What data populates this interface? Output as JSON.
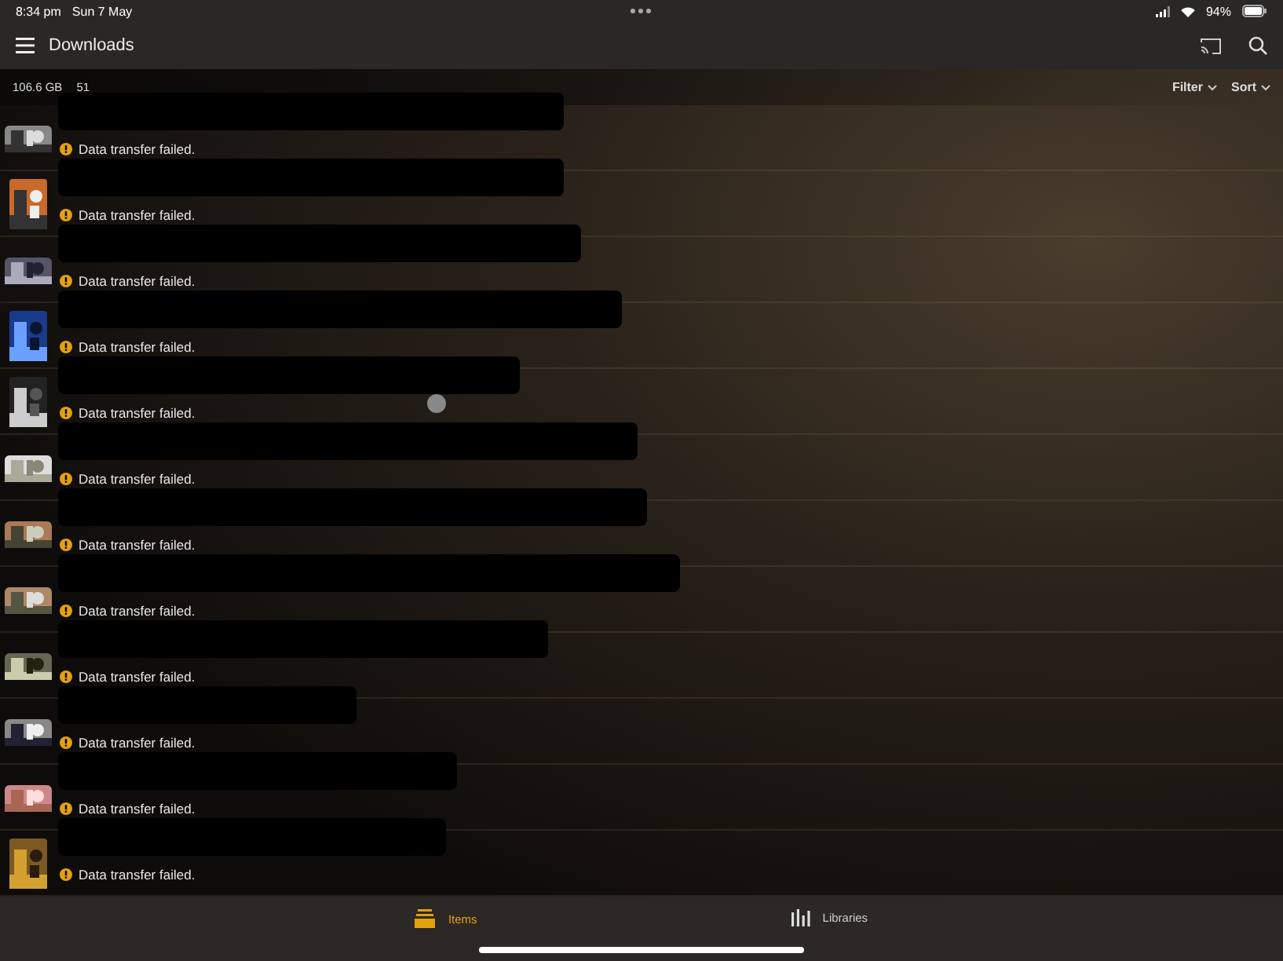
{
  "status_bar": {
    "time": "8:34 pm",
    "date": "Sun 7 May",
    "battery": "94%"
  },
  "nav": {
    "title": "Downloads"
  },
  "summary": {
    "size": "106.6 GB",
    "count": "51",
    "filter": "Filter",
    "sort": "Sort"
  },
  "downloads": [
    {
      "status": "Data transfer failed."
    },
    {
      "status": "Data transfer failed."
    },
    {
      "status": "Data transfer failed."
    },
    {
      "status": "Data transfer failed."
    },
    {
      "status": "Data transfer failed."
    },
    {
      "status": "Data transfer failed."
    },
    {
      "status": "Data transfer failed."
    },
    {
      "status": "Data transfer failed."
    },
    {
      "status": "Data transfer failed."
    },
    {
      "status": "Data transfer failed."
    },
    {
      "status": "Data transfer failed."
    },
    {
      "status": "Data transfer failed."
    }
  ],
  "tabs": [
    {
      "label": "Items",
      "selected": true,
      "kind": "items"
    },
    {
      "label": "Libraries",
      "selected": false,
      "kind": "libraries"
    }
  ]
}
